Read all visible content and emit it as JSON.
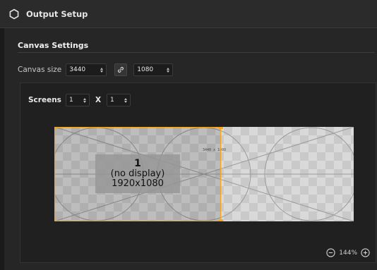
{
  "window": {
    "title": "Output Setup",
    "icon": "hexagon-icon"
  },
  "canvas_settings": {
    "title": "Canvas Settings",
    "size_label": "Canvas size",
    "width": "3440",
    "height": "1080",
    "link_icon": "link-icon"
  },
  "screens": {
    "label": "Screens",
    "cols": "1",
    "separator": "X",
    "rows": "1"
  },
  "screen_tile": {
    "number": "1",
    "status": "(no display)",
    "resolution": "1920x1080",
    "canvas_text": "3440 x 1080"
  },
  "zoom": {
    "level": "144%",
    "zoom_out_icon": "zoom-out-icon",
    "zoom_in_icon": "zoom-in-icon"
  },
  "colors": {
    "selection": "#f5a623",
    "background": "#1a1a1a",
    "panel": "#262626"
  }
}
